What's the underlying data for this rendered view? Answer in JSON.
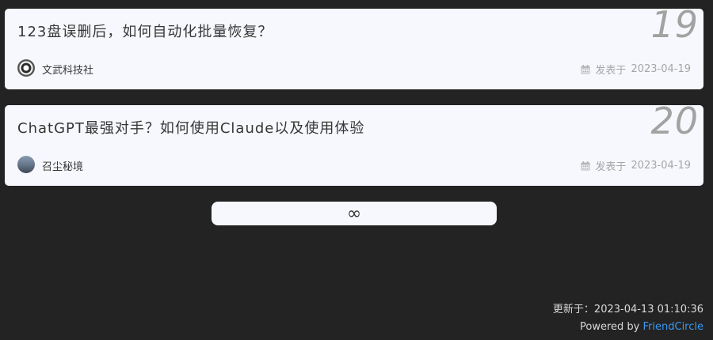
{
  "posts": [
    {
      "number": "19",
      "title": "123盘误删后，如何自动化批量恢复？",
      "author": "文武科技社",
      "date_prefix": "发表于",
      "date": "2023-04-19"
    },
    {
      "number": "20",
      "title": "ChatGPT最强对手？如何使用Claude以及使用体验",
      "author": "召尘秘境",
      "date_prefix": "发表于",
      "date": "2023-04-19"
    }
  ],
  "load_more": {
    "label": "∞"
  },
  "footer": {
    "updated": "更新于：2023-04-13 01:10:36",
    "powered_prefix": "Powered by",
    "powered_link": "FriendCircle"
  },
  "colors": {
    "background": "#232323",
    "card": "#f7f8fd",
    "link": "#3a98f0"
  },
  "icons": [
    "calendar-icon",
    "avatar"
  ]
}
